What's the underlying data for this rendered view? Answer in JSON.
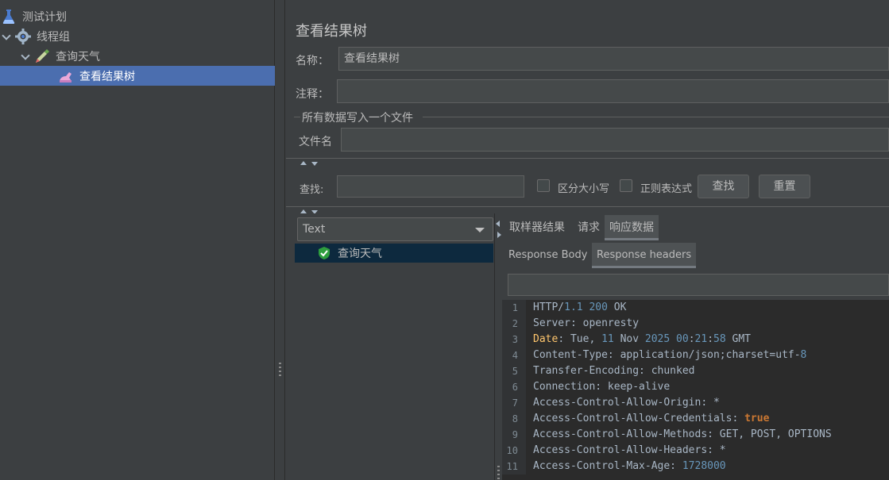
{
  "tree": {
    "items": [
      {
        "label": "测试计划",
        "icon": "flask-icon"
      },
      {
        "label": "线程组",
        "icon": "gear-icon"
      },
      {
        "label": "查询天气",
        "icon": "pipette-icon"
      },
      {
        "label": "查看结果树",
        "icon": "result-tree-icon"
      }
    ]
  },
  "panel": {
    "title": "查看结果树",
    "name_label": "名称：",
    "name_value": "查看结果树",
    "comment_label": "注释：",
    "comment_value": "",
    "file_group_title": "所有数据写入一个文件",
    "filename_label": "文件名",
    "filename_value": ""
  },
  "search": {
    "label": "查找:",
    "value": "",
    "case_label": "区分大小写",
    "regex_label": "正则表达式",
    "find_button": "查找",
    "reset_button": "重置"
  },
  "results": {
    "renderer": "Text",
    "samples": [
      {
        "label": "查询天气",
        "status": "success"
      }
    ],
    "tabs": [
      "取样器结果",
      "请求",
      "响应数据"
    ],
    "active_tab": "响应数据",
    "subtabs": [
      "Response Body",
      "Response headers"
    ],
    "active_subtab": "Response headers"
  },
  "colors": {
    "background": "#3c3f41",
    "selection": "#4b6eaf",
    "editor_bg": "#2b2b2b",
    "number": "#6897bb",
    "keyword": "#cc7832",
    "success": "#2e9e3e"
  },
  "code_lines": [
    {
      "n": "1",
      "parts": [
        {
          "t": "HTTP/"
        },
        {
          "t": "1.1",
          "c": "num"
        },
        {
          "t": " "
        },
        {
          "t": "200",
          "c": "num"
        },
        {
          "t": " OK"
        }
      ]
    },
    {
      "n": "2",
      "parts": [
        {
          "t": "Server: openresty"
        }
      ]
    },
    {
      "n": "3",
      "parts": [
        {
          "t": "Date",
          "c": "hl"
        },
        {
          "t": ": Tue, "
        },
        {
          "t": "11",
          "c": "num"
        },
        {
          "t": " Nov "
        },
        {
          "t": "2025",
          "c": "num"
        },
        {
          "t": " "
        },
        {
          "t": "00",
          "c": "num"
        },
        {
          "t": ":"
        },
        {
          "t": "21",
          "c": "num"
        },
        {
          "t": ":"
        },
        {
          "t": "58",
          "c": "num"
        },
        {
          "t": " GMT"
        }
      ]
    },
    {
      "n": "4",
      "parts": [
        {
          "t": "Content-Type: application/json;charset=utf-"
        },
        {
          "t": "8",
          "c": "num"
        }
      ]
    },
    {
      "n": "5",
      "parts": [
        {
          "t": "Transfer-Encoding: chunked"
        }
      ]
    },
    {
      "n": "6",
      "parts": [
        {
          "t": "Connection: keep-alive"
        }
      ]
    },
    {
      "n": "7",
      "parts": [
        {
          "t": "Access-Control-Allow-Origin: *"
        }
      ]
    },
    {
      "n": "8",
      "parts": [
        {
          "t": "Access-Control-Allow-Credentials: "
        },
        {
          "t": "true",
          "c": "kw"
        }
      ]
    },
    {
      "n": "9",
      "parts": [
        {
          "t": "Access-Control-Allow-Methods: GET, POST, OPTIONS"
        }
      ]
    },
    {
      "n": "10",
      "parts": [
        {
          "t": "Access-Control-Allow-Headers: *"
        }
      ]
    },
    {
      "n": "11",
      "parts": [
        {
          "t": "Access-Control-Max-Age: "
        },
        {
          "t": "1728000",
          "c": "num"
        }
      ]
    }
  ]
}
